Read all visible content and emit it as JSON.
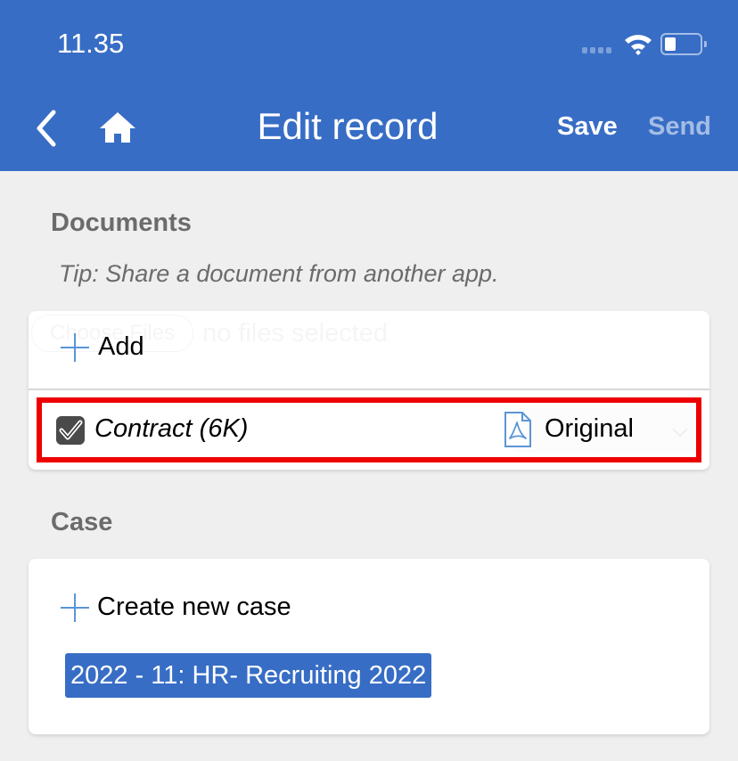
{
  "status_bar": {
    "time": "11.35",
    "signal_icon": "cellular-signal-icon",
    "wifi_icon": "wifi-icon",
    "battery_icon": "battery-icon"
  },
  "header": {
    "title": "Edit record",
    "back_icon": "chevron-left-icon",
    "home_icon": "home-icon",
    "save_label": "Save",
    "send_label": "Send",
    "bar_color": "#376dc5"
  },
  "documents": {
    "section_label": "Documents",
    "tip": "Tip: Share a document from another app.",
    "file_input": {
      "button_label": "Choose Files",
      "status": "no files selected"
    },
    "add_label": "Add",
    "items": [
      {
        "name": "Contract (6K)",
        "checked": true,
        "file_type_icon": "pdf-file-icon",
        "version": "Original",
        "highlight_color": "#ee0000"
      }
    ]
  },
  "case": {
    "section_label": "Case",
    "create_label": "Create new case",
    "selected_case": "2022 - 11: HR- Recruiting 2022"
  }
}
